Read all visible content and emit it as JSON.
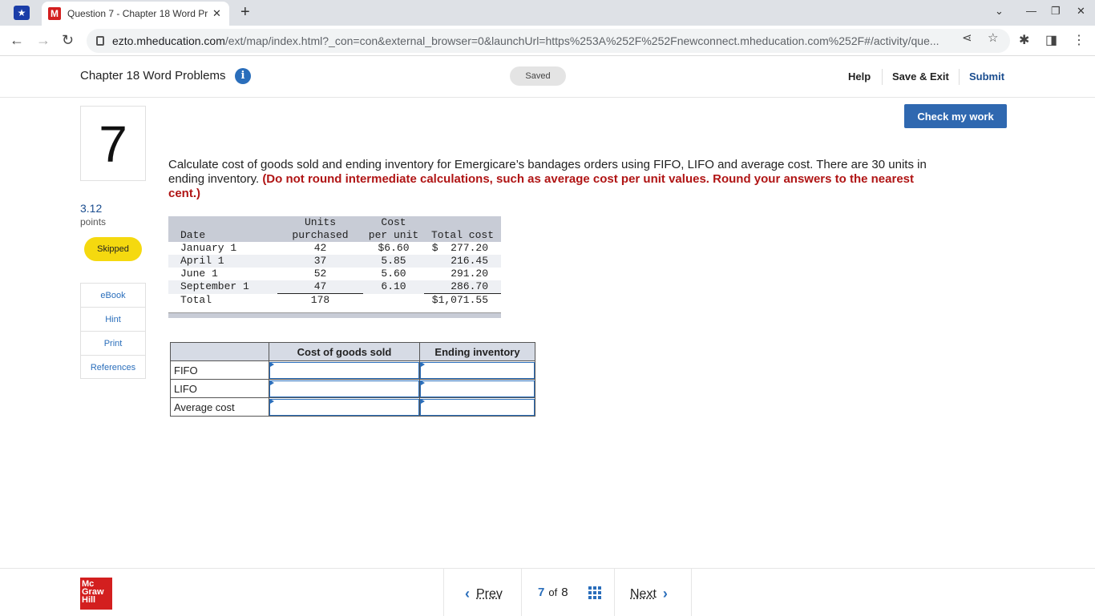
{
  "browser": {
    "tab_title": "Question 7 - Chapter 18 Word Pr",
    "url_host": "ezto.mheducation.com",
    "url_path": "/ext/map/index.html?_con=con&external_browser=0&launchUrl=https%253A%252F%252Fnewconnect.mheducation.com%252F#/activity/que..."
  },
  "header": {
    "assignment_title": "Chapter 18 Word Problems",
    "saved_label": "Saved",
    "help_label": "Help",
    "save_exit_label": "Save & Exit",
    "submit_label": "Submit"
  },
  "question": {
    "number": "7",
    "points_value": "3.12",
    "points_label": "points",
    "status": "Skipped",
    "check_label": "Check my work",
    "prompt": "Calculate cost of goods sold and ending inventory for Emergicare’s bandages orders using FIFO, LIFO and average cost. There are 30 units in ending inventory.",
    "instruction": "(Do not round intermediate calculations, such as average cost per unit values. Round your answers to the nearest cent.)"
  },
  "sidebar": {
    "items": [
      "eBook",
      "Hint",
      "Print",
      "References"
    ]
  },
  "purchases": {
    "headers": {
      "date": "Date",
      "units_1": "Units",
      "units_2": "purchased",
      "cost_1": "Cost",
      "cost_2": "per unit",
      "total": "Total cost"
    },
    "rows": [
      {
        "date": "January 1",
        "units": "42",
        "cost": "$6.60",
        "total": "$  277.20"
      },
      {
        "date": "April 1",
        "units": "37",
        "cost": "5.85",
        "total": "216.45"
      },
      {
        "date": "June 1",
        "units": "52",
        "cost": "5.60",
        "total": "291.20"
      },
      {
        "date": "September 1",
        "units": "47",
        "cost": "6.10",
        "total": "286.70"
      }
    ],
    "total_row": {
      "label": "Total",
      "units": "178",
      "total": "$1,071.55"
    }
  },
  "answer": {
    "col_cogs": "Cost of goods sold",
    "col_ending": "Ending inventory",
    "rows": [
      "FIFO",
      "LIFO",
      "Average cost"
    ]
  },
  "footer": {
    "logo_text": "Mc Graw Hill",
    "prev_label": "Prev",
    "current_page": "7",
    "of_label": "of",
    "total_pages": "8",
    "next_label": "Next"
  }
}
